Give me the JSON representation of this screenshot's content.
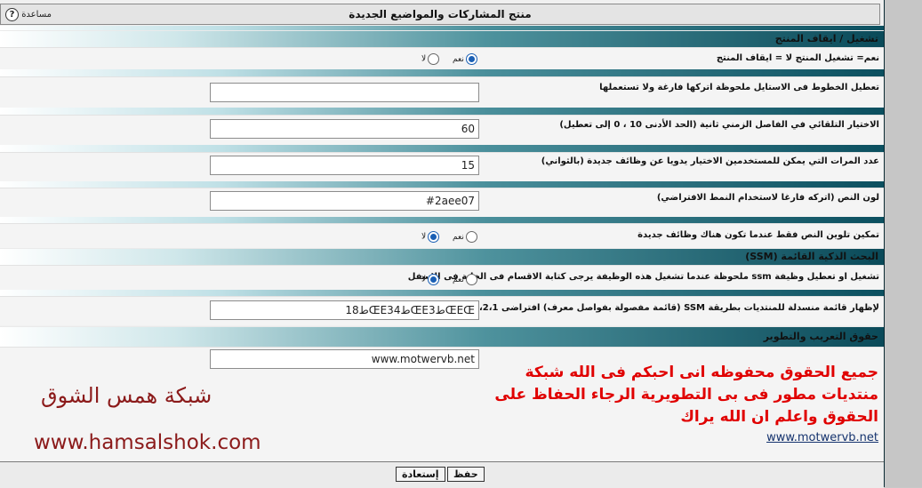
{
  "header": {
    "title": "منتج المشاركات والمواضيع الجديدة",
    "help_label": "مساعدة",
    "help_icon": "?"
  },
  "sections": {
    "s1": "تشغيل / ايقاف المنتج",
    "s2": "البحث الذكية القائمة (SSM)",
    "s3": "حقوق التعريب والتطوير"
  },
  "rows": [
    {
      "label": "نعم= تشغيل المنتج لا = ايقاف المنتج",
      "yes": "نعم",
      "no": "لا",
      "selected": "yes"
    },
    {
      "label": "تعطيل الخطوط فى الاستايل ملحوظة اتركها فارغة ولا تستعملها",
      "value": ""
    },
    {
      "label": "الاختيار التلقائي في الفاصل الزمني ثانية (الحد الأدنى 10 ، 0 إلى تعطيل)",
      "value": "60"
    },
    {
      "label": "عدد المرات التي يمكن للمستخدمين الاختيار يدويا عن وظائف جديدة (بالثواني)",
      "value": "15"
    },
    {
      "label": "لون النص (اتركه فارغا لاستخدام النمط الافتراضي)",
      "value": "#2aee07"
    },
    {
      "label": "تمكين تلوين النص فقط عندما تكون هناك وظائف جديدة",
      "yes": "نعم",
      "no": "لا",
      "selected": "no"
    },
    {
      "label": "تشغيل او تعطيل وظيفة ssm ملحوظة عندما تشغيل هذه الوظيفة يرجى كتابة الاقسام فى الخانة فى الاسفل",
      "yes": "نعم",
      "no": "لا",
      "selected": "no"
    },
    {
      "label": "لإظهار قائمة منسدلة للمنتديات بطريقة SSM (قائمة مفصولة بفواصل معرف) افتراضى 4،3،2،1",
      "value": "1ط8ŒE3ط4ŒEط3ŒEŒ"
    }
  ],
  "credits": {
    "url_value": "www.motwervb.net",
    "text": "جميع الحقوق محفوظه انى احبكم فى الله شبكة منتديات مطور فى بى التطويرية الرجاء الحفاظ على الحقوق واعلم ان الله يراك",
    "link": "www.motwervb.net"
  },
  "watermark": {
    "arabic": "شبكة همس الشوق",
    "url": "www.hamsalshok.com"
  },
  "buttons": {
    "save": "حفظ",
    "reset": "إستعادة"
  },
  "colors": {
    "band_dark": "#0b4f5f",
    "red_text": "#e00000",
    "watermark": "#8b1a1a",
    "radio_on": "#1a5fb4"
  }
}
